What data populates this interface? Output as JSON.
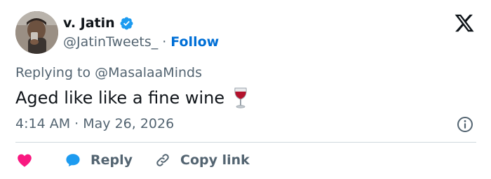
{
  "author": {
    "display_name": "v. Jatin",
    "handle": "@JatinTweets_",
    "separator": "·",
    "follow_label": "Follow"
  },
  "reply_context": {
    "prefix": "Replying to ",
    "mention": "@MasalaaMinds"
  },
  "tweet": {
    "text": "Aged like like a fine wine",
    "emoji_icon": "wine-glass-icon"
  },
  "meta": {
    "time": "4:14 AM",
    "separator": "·",
    "date": "May 26, 2026"
  },
  "actions": {
    "reply_label": "Reply",
    "copy_link_label": "Copy link"
  },
  "icons": {
    "verified": "verified-badge-icon",
    "logo": "x-logo-icon",
    "info": "info-icon",
    "like": "heart-icon",
    "reply": "reply-bubble-icon",
    "link": "link-icon"
  },
  "colors": {
    "text_primary": "#0f1419",
    "text_secondary": "#536471",
    "link_blue": "#006fd6",
    "verified_blue": "#1d9bf0",
    "heart_pink": "#f91880",
    "divider": "#cfd9de"
  }
}
